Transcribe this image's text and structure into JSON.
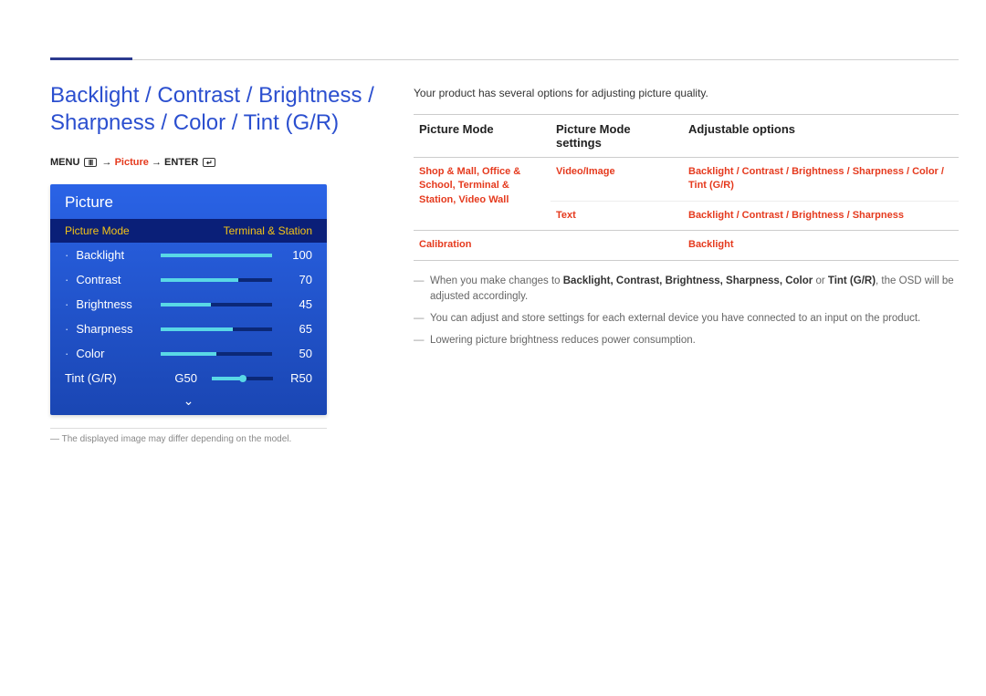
{
  "title": "Backlight / Contrast / Brightness / Sharpness / Color / Tint (G/R)",
  "breadcrumb": {
    "prefix": "MENU",
    "sep1": "→",
    "highlight": "Picture",
    "sep2": "→",
    "suffix": "ENTER"
  },
  "osd": {
    "panel_title": "Picture",
    "mode_label": "Picture Mode",
    "mode_value": "Terminal & Station",
    "items": [
      {
        "name": "Backlight",
        "value": 100
      },
      {
        "name": "Contrast",
        "value": 70
      },
      {
        "name": "Brightness",
        "value": 45
      },
      {
        "name": "Sharpness",
        "value": 65
      },
      {
        "name": "Color",
        "value": 50
      }
    ],
    "tint": {
      "name": "Tint (G/R)",
      "g": "G50",
      "r": "R50"
    }
  },
  "footnote_left": "The displayed image may differ depending on the model.",
  "intro": "Your product has several options for adjusting picture quality.",
  "table": {
    "headers": [
      "Picture Mode",
      "Picture Mode settings",
      "Adjustable options"
    ],
    "rows": [
      {
        "c0": "Shop & Mall, Office & School, Terminal & Station, Video Wall",
        "c1": "Video/Image",
        "c2": "Backlight / Contrast / Brightness / Sharpness / Color / Tint (G/R)"
      },
      {
        "c0": "",
        "c1": "Text",
        "c2": "Backlight / Contrast / Brightness / Sharpness"
      },
      {
        "c0": "Calibration",
        "c1": "",
        "c2": "Backlight"
      }
    ]
  },
  "notes": {
    "n1_pre": "When you make changes to ",
    "n1_bold": "Backlight, Contrast, Brightness, Sharpness, Color",
    "n1_mid": " or ",
    "n1_bold2": "Tint (G/R)",
    "n1_post": ", the OSD will be adjusted accordingly.",
    "n2": "You can adjust and store settings for each external device you have connected to an input on the product.",
    "n3": "Lowering picture brightness reduces power consumption."
  }
}
